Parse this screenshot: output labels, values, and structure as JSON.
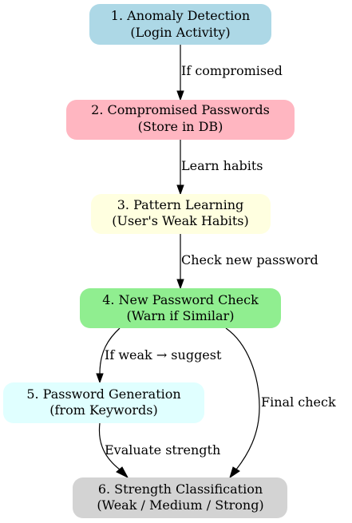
{
  "nodes": [
    {
      "id": "n1",
      "line1": "1. Anomaly Detection",
      "line2": "(Login Activity)",
      "color": "#add8e6"
    },
    {
      "id": "n2",
      "line1": "2. Compromised Passwords",
      "line2": "(Store in DB)",
      "color": "#ffb6c1"
    },
    {
      "id": "n3",
      "line1": "3. Pattern Learning",
      "line2": "(User's Weak Habits)",
      "color": "#ffffe0"
    },
    {
      "id": "n4",
      "line1": "4. New Password Check",
      "line2": "(Warn if Similar)",
      "color": "#90ee90"
    },
    {
      "id": "n5",
      "line1": "5. Password Generation",
      "line2": "(from Keywords)",
      "color": "#e0ffff"
    },
    {
      "id": "n6",
      "line1": "6. Strength Classification",
      "line2": "(Weak / Medium / Strong)",
      "color": "#d3d3d3"
    }
  ],
  "edges": [
    {
      "from": "n1",
      "to": "n2",
      "label": "If compromised"
    },
    {
      "from": "n2",
      "to": "n3",
      "label": "Learn habits"
    },
    {
      "from": "n3",
      "to": "n4",
      "label": "Check new password"
    },
    {
      "from": "n4",
      "to": "n5",
      "label": "If weak → suggest"
    },
    {
      "from": "n5",
      "to": "n6",
      "label": "Evaluate strength"
    },
    {
      "from": "n4",
      "to": "n6",
      "label": "Final check"
    }
  ]
}
